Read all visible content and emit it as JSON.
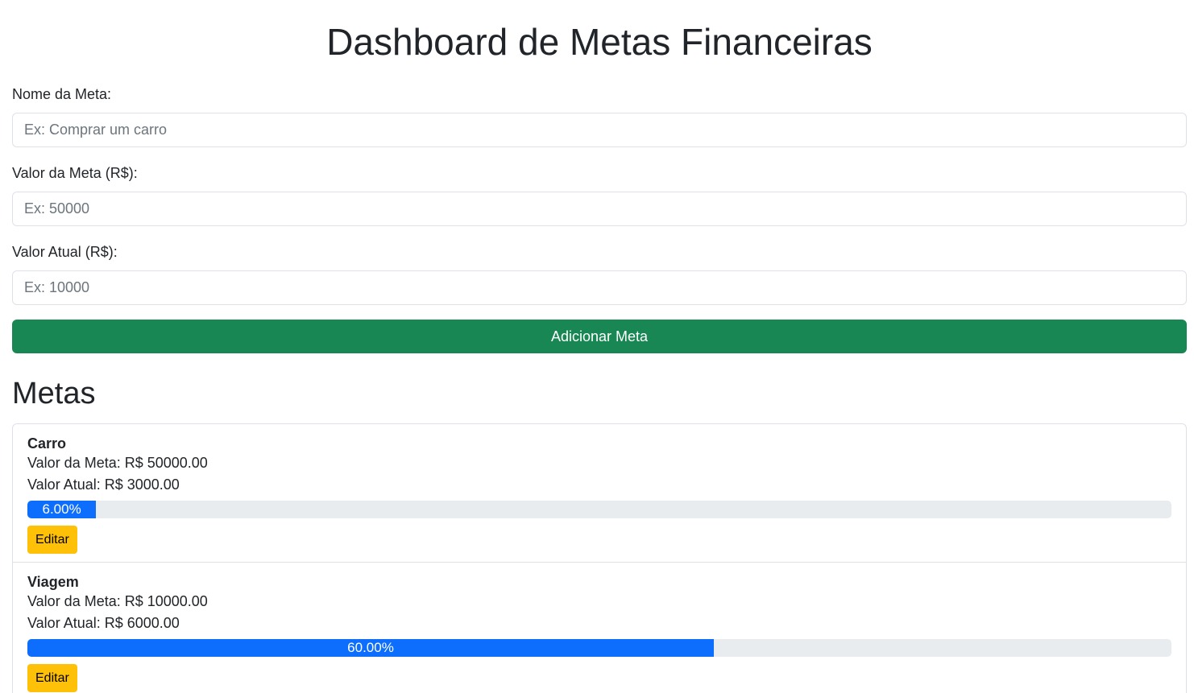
{
  "page": {
    "title": "Dashboard de Metas Financeiras"
  },
  "form": {
    "name_label": "Nome da Meta:",
    "name_placeholder": "Ex: Comprar um carro",
    "name_value": "",
    "target_label": "Valor da Meta (R$):",
    "target_placeholder": "Ex: 50000",
    "target_value": "",
    "current_label": "Valor Atual (R$):",
    "current_placeholder": "Ex: 10000",
    "current_value": "",
    "add_button_label": "Adicionar Meta"
  },
  "goals_section": {
    "title": "Metas"
  },
  "goals": [
    {
      "name": "Carro",
      "target_text": "Valor da Meta: R$ 50000.00",
      "current_text": "Valor Atual: R$ 3000.00",
      "progress_percent": 6,
      "progress_label": "6.00%",
      "edit_label": "Editar"
    },
    {
      "name": "Viagem",
      "target_text": "Valor da Meta: R$ 10000.00",
      "current_text": "Valor Atual: R$ 6000.00",
      "progress_percent": 60,
      "progress_label": "60.00%",
      "edit_label": "Editar"
    }
  ],
  "colors": {
    "primary_button": "#198754",
    "progress_fill": "#0d6efd",
    "progress_track": "#e9ecef",
    "edit_button": "#ffc107"
  }
}
